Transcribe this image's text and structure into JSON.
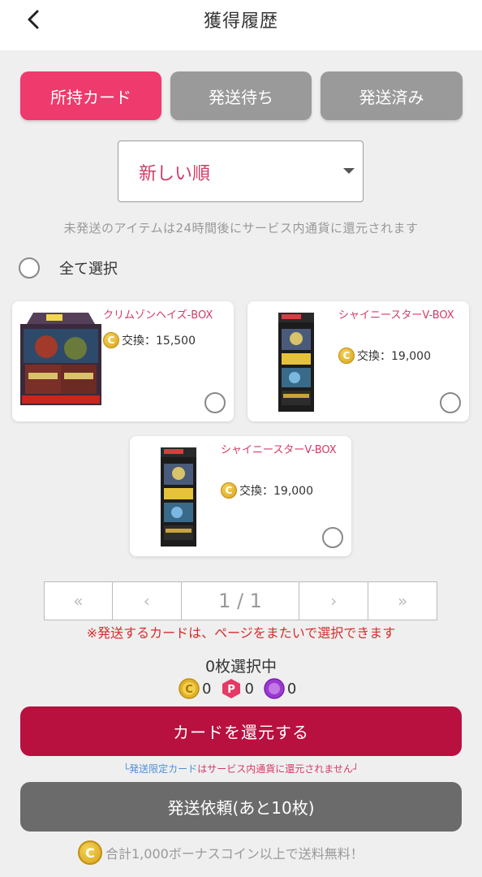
{
  "header": {
    "title": "獲得履歴",
    "back_icon": "chevron-left-icon"
  },
  "tabs": [
    {
      "label": "所持カード",
      "active": true
    },
    {
      "label": "発送待ち",
      "active": false
    },
    {
      "label": "発送済み",
      "active": false
    }
  ],
  "sort": {
    "selected": "新しい順"
  },
  "notice": "未発送のアイテムは24時間後にサービス内通貨に還元されます",
  "select_all": {
    "label": "全て選択",
    "checked": false
  },
  "cards": [
    {
      "name": "クリムゾンヘイズ-BOX",
      "price_label": "交換：15,500",
      "coin_icon": "coin-icon",
      "selected": false
    },
    {
      "name": "シャイニースターV-BOX",
      "price_label": "交換：19,000",
      "coin_icon": "coin-icon",
      "selected": false
    },
    {
      "name": "シャイニースターV-BOX",
      "price_label": "交換：19,000",
      "coin_icon": "coin-icon",
      "selected": false
    }
  ],
  "pagination": {
    "first": "«",
    "prev": "‹",
    "current": "1 / 1",
    "next": "›",
    "last": "»"
  },
  "pagination_note": "※発送するカードは、ページをまたいで選択できます",
  "selection": {
    "count_label": "0枚選択中"
  },
  "balances": {
    "coin": "0",
    "point": "0",
    "special": "0"
  },
  "buttons": {
    "return_label": "カードを還元する",
    "ship_label": "発送依頼(あと10枚)"
  },
  "return_note": {
    "prefix": "└",
    "highlight": "発送限定カード",
    "rest": "はサービス内通貨に還元されません┘"
  },
  "bonus_note": "合計1,000ボーナスコイン以上で送料無料！",
  "colors": {
    "accent_pink": "#ee3a6c",
    "return_button": "#b8103f",
    "ship_button": "#6b6b6b"
  }
}
